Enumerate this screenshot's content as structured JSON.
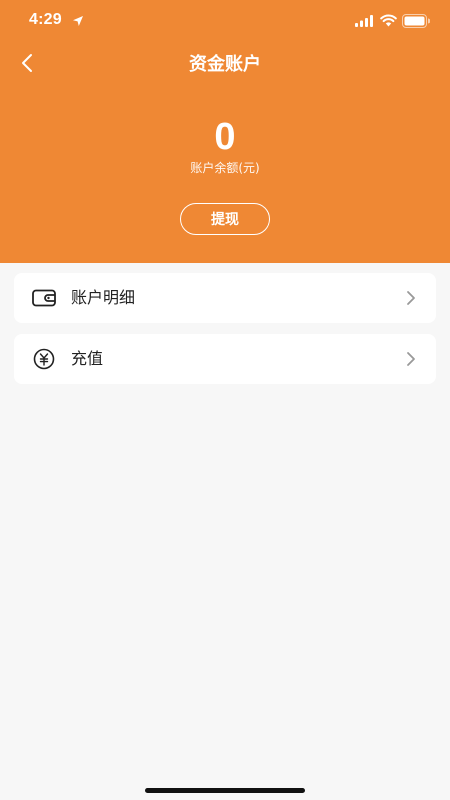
{
  "status_bar": {
    "time": "4:29"
  },
  "nav": {
    "title": "资金账户",
    "back_icon": "chevron-left-icon"
  },
  "balance": {
    "value": "0",
    "label": "账户余额(元)"
  },
  "actions": {
    "withdraw_label": "提现"
  },
  "menu": [
    {
      "label": "账户明细",
      "icon": "wallet-icon"
    },
    {
      "label": "充值",
      "icon": "yuan-coin-icon"
    }
  ],
  "colors": {
    "header_bg": "#ef8834",
    "page_bg": "#f7f7f7",
    "card_bg": "#ffffff",
    "text_primary": "#222222",
    "chevron": "#999999"
  }
}
